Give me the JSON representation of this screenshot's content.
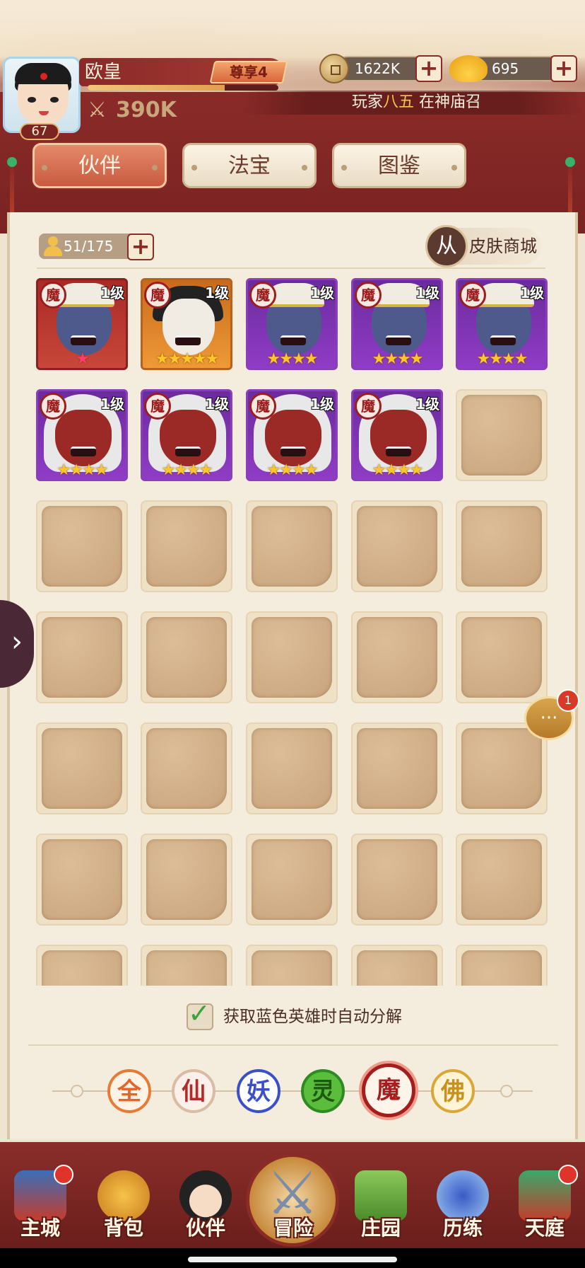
{
  "player": {
    "name": "欧皇",
    "vip": "尊享4",
    "level": "67",
    "power": "390K",
    "exp_progress": 0.72
  },
  "resources": {
    "coins": "1622K",
    "ingots": "695"
  },
  "broadcast": {
    "prefix": "玩家",
    "player": "八五",
    "suffix": " 在神庙召"
  },
  "tabs": [
    {
      "label": "伙伴",
      "active": true
    },
    {
      "label": "法宝",
      "active": false
    },
    {
      "label": "图鉴",
      "active": false
    }
  ],
  "slots": {
    "count": "51/175"
  },
  "skin_shop": {
    "label": "皮肤商城"
  },
  "heroes": [
    {
      "seal": "魔",
      "level": "1级",
      "stars": "★",
      "rarity": "red",
      "face": "blue"
    },
    {
      "seal": "魔",
      "level": "1级",
      "stars": "★★★★★",
      "rarity": "orange",
      "face": "pale"
    },
    {
      "seal": "魔",
      "level": "1级",
      "stars": "★★★★",
      "rarity": "purple",
      "face": "blue"
    },
    {
      "seal": "魔",
      "level": "1级",
      "stars": "★★★★",
      "rarity": "purple",
      "face": "blue"
    },
    {
      "seal": "魔",
      "level": "1级",
      "stars": "★★★★",
      "rarity": "purple",
      "face": "blue"
    },
    {
      "seal": "魔",
      "level": "1级",
      "stars": "★★★★",
      "rarity": "purple",
      "face": "red"
    },
    {
      "seal": "魔",
      "level": "1级",
      "stars": "★★★★",
      "rarity": "purple",
      "face": "red"
    },
    {
      "seal": "魔",
      "level": "1级",
      "stars": "★★★★",
      "rarity": "purple",
      "face": "red"
    },
    {
      "seal": "魔",
      "level": "1级",
      "stars": "★★★★",
      "rarity": "purple",
      "face": "red"
    }
  ],
  "auto_decompose": {
    "label": "获取蓝色英雄时自动分解",
    "checked": true
  },
  "faction_filters": [
    {
      "label": "全",
      "name": "all"
    },
    {
      "label": "仙",
      "name": "xian"
    },
    {
      "label": "妖",
      "name": "yao"
    },
    {
      "label": "灵",
      "name": "ling"
    },
    {
      "label": "魔",
      "name": "mo",
      "selected": true
    },
    {
      "label": "佛",
      "name": "fo"
    }
  ],
  "chat": {
    "badge": "1"
  },
  "nav": [
    {
      "label": "主城",
      "badge": true
    },
    {
      "label": "背包",
      "badge": false
    },
    {
      "label": "伙伴",
      "badge": false
    },
    {
      "label": "冒险",
      "badge": false
    },
    {
      "label": "庄园",
      "badge": false
    },
    {
      "label": "历练",
      "badge": false
    },
    {
      "label": "天庭",
      "badge": true
    }
  ],
  "colors": {
    "primary_red": "#8a2b26",
    "panel_bg": "#f4ecdd",
    "tab_active": "#c85a40",
    "star_gold": "#ffc629"
  },
  "icons": {
    "coin": "copper-coin-icon",
    "ingot": "gold-ingot-icon",
    "power": "crossed-swords-icon",
    "skin": "skin-shop-icon",
    "chat": "chat-bubble-icon",
    "expand": "chevron-right-icon"
  }
}
